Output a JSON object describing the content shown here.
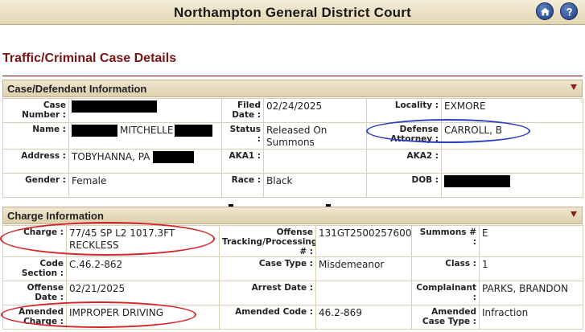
{
  "header": {
    "court_name": "Northampton General District Court",
    "home_icon": "home-icon",
    "help_icon": "help-icon"
  },
  "page_title": "Traffic/Criminal Case Details",
  "case_section": {
    "title": "Case/Defendant Information",
    "case_number_label": "Case Number :",
    "name_label": "Name :",
    "name_value": "MITCHELLE",
    "address_label": "Address :",
    "address_value": "TOBYHANNA, PA",
    "gender_label": "Gender :",
    "gender_value": "Female",
    "filed_date_label": "Filed Date :",
    "filed_date_value": "02/24/2025",
    "status_label": "Status :",
    "status_value": "Released On Summons",
    "aka1_label": "AKA1 :",
    "aka1_value": "",
    "race_label": "Race :",
    "race_value": "Black",
    "locality_label": "Locality :",
    "locality_value": "EXMORE",
    "defense_attorney_label": "Defense Attorney :",
    "defense_attorney_value": "CARROLL, B",
    "aka2_label": "AKA2 :",
    "aka2_value": "",
    "dob_label": "DOB :"
  },
  "charge_section": {
    "title": "Charge Information",
    "charge_label": "Charge :",
    "charge_value": "77/45 SP L2 1017.3FT RECKLESS",
    "code_section_label": "Code Section :",
    "code_section_value": "C.46.2-862",
    "offense_date_label": "Offense Date :",
    "offense_date_value": "02/21/2025",
    "amended_charge_label": "Amended Charge :",
    "amended_charge_value": "IMPROPER DRIVING",
    "offense_tracking_label": "Offense Tracking/Processing # :",
    "offense_tracking_value": "131GT2500257600",
    "case_type_label": "Case Type :",
    "case_type_value": "Misdemeanor",
    "arrest_date_label": "Arrest Date :",
    "arrest_date_value": "",
    "amended_code_label": "Amended Code :",
    "amended_code_value": "46.2-869",
    "summons_label": "Summons # :",
    "summons_value": "E",
    "class_label": "Class :",
    "class_value": "1",
    "complainant_label": "Complainant :",
    "complainant_value": "PARKS, BRANDON",
    "amended_case_type_label": "Amended Case Type :",
    "amended_case_type_value": "Infraction"
  },
  "colors": {
    "title_red": "#7a1414",
    "annotation_red": "#d6252a",
    "annotation_blue": "#2b3ec2",
    "header_tan": "#e4d6b2"
  }
}
